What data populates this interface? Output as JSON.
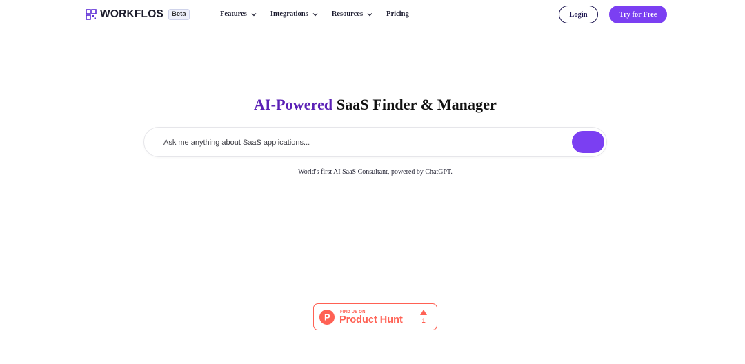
{
  "header": {
    "logo": {
      "name": "WORKFLOS",
      "icon": "grid-logo-icon",
      "badge": "Beta"
    },
    "nav": [
      {
        "label": "Features",
        "has_dropdown": true
      },
      {
        "label": "Integrations",
        "has_dropdown": true
      },
      {
        "label": "Resources",
        "has_dropdown": true
      },
      {
        "label": "Pricing",
        "has_dropdown": false
      }
    ],
    "login_label": "Login",
    "try_label": "Try for Free"
  },
  "hero": {
    "title_accent": "AI-Powered",
    "title_rest": " SaaS Finder & Manager",
    "search_placeholder": "Ask me anything about SaaS applications...",
    "search_value": "",
    "subtitle": "World's first AI SaaS Consultant, powered by ChatGPT."
  },
  "product_hunt": {
    "eyebrow": "FIND US ON",
    "name": "Product Hunt",
    "upvotes": "1",
    "logo_letter": "P",
    "upvote_icon": "triangle-up-icon"
  },
  "colors": {
    "brand_purple": "#7b3ff2",
    "title_accent": "#5b21b6",
    "login_border": "#1c1550",
    "product_hunt": "#ff6154"
  }
}
